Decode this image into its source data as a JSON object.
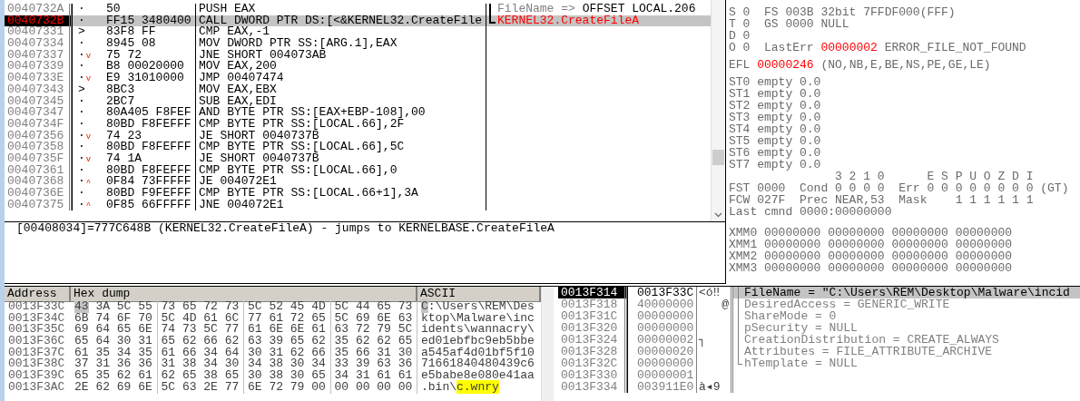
{
  "disassembly": {
    "rows": [
      {
        "address": "0040732A",
        "mark": "·",
        "jump": "",
        "hex": "50",
        "instruction": "PUSH EAX",
        "selected": false,
        "comment": {
          "kind": "arg",
          "label": "FileName =>",
          "value": "OFFSET LOCAL.206"
        }
      },
      {
        "address": "0040732B",
        "mark": "·",
        "jump": "",
        "hex": "FF15 3480400",
        "instruction": "CALL DWORD PTR DS:[<&KERNEL32.CreateFile",
        "selected": true,
        "comment": {
          "kind": "api",
          "value": "KERNEL32.CreateFileA"
        }
      },
      {
        "address": "00407331",
        "mark": ">",
        "jump": "",
        "hex": "83F8 FF",
        "instruction": "CMP EAX,-1",
        "selected": false
      },
      {
        "address": "00407334",
        "mark": "·",
        "jump": "",
        "hex": "8945 08",
        "instruction": "MOV DWORD PTR SS:[ARG.1],EAX",
        "selected": false
      },
      {
        "address": "00407337",
        "mark": "·",
        "jump": "v",
        "hex": "75 72",
        "instruction": "JNE SHORT 004073AB",
        "selected": false
      },
      {
        "address": "00407339",
        "mark": "·",
        "jump": "",
        "hex": "B8 00020000",
        "instruction": "MOV EAX,200",
        "selected": false
      },
      {
        "address": "0040733E",
        "mark": "·",
        "jump": "v",
        "hex": "E9 31010000",
        "instruction": "JMP 00407474",
        "selected": false
      },
      {
        "address": "00407343",
        "mark": ">",
        "jump": "",
        "hex": "8BC3",
        "instruction": "MOV EAX,EBX",
        "selected": false
      },
      {
        "address": "00407345",
        "mark": "·",
        "jump": "",
        "hex": "2BC7",
        "instruction": "SUB EAX,EDI",
        "selected": false
      },
      {
        "address": "00407347",
        "mark": "·",
        "jump": "",
        "hex": "80A405 F8FEF",
        "instruction": "AND BYTE PTR SS:[EAX+EBP-108],00",
        "selected": false
      },
      {
        "address": "0040734F",
        "mark": "·",
        "jump": "",
        "hex": "80BD F8FEFFF",
        "instruction": "CMP BYTE PTR SS:[LOCAL.66],2F",
        "selected": false
      },
      {
        "address": "00407356",
        "mark": "·",
        "jump": "v",
        "hex": "74 23",
        "instruction": "JE SHORT 0040737B",
        "selected": false
      },
      {
        "address": "00407358",
        "mark": "·",
        "jump": "",
        "hex": "80BD F8FEFFF",
        "instruction": "CMP BYTE PTR SS:[LOCAL.66],5C",
        "selected": false
      },
      {
        "address": "0040735F",
        "mark": "·",
        "jump": "v",
        "hex": "74 1A",
        "instruction": "JE SHORT 0040737B",
        "selected": false
      },
      {
        "address": "00407361",
        "mark": "·",
        "jump": "",
        "hex": "80BD F8FEFFF",
        "instruction": "CMP BYTE PTR SS:[LOCAL.66],0",
        "selected": false
      },
      {
        "address": "00407368",
        "mark": "·",
        "jump": "^",
        "hex": "0F84 73FFFFF",
        "instruction": "JE 004072E1",
        "selected": false
      },
      {
        "address": "0040736E",
        "mark": "·",
        "jump": "",
        "hex": "80BD F9FEFFF",
        "instruction": "CMP BYTE PTR SS:[LOCAL.66+1],3A",
        "selected": false
      },
      {
        "address": "00407375",
        "mark": "·",
        "jump": "^",
        "hex": "0F85 66FFFFF",
        "instruction": "JNE 004072E1",
        "selected": false
      }
    ]
  },
  "info_line": "[00408034]=777C648B (KERNEL32.CreateFileA) - jumps to KERNELBASE.CreateFileA",
  "registers": {
    "groups": [
      [
        [
          {
            "text": "S 0  FS 003B 32bit 7FFDF000(FFF)",
            "changed": false
          }
        ],
        [
          {
            "text": "T 0  GS 0000 NULL",
            "changed": false
          }
        ],
        [
          {
            "text": "D 0",
            "changed": false
          }
        ],
        [
          {
            "text": "O 0  LastErr ",
            "changed": false
          },
          {
            "text": "00000002",
            "changed": true
          },
          {
            "text": " ERROR_FILE_NOT_FOUND",
            "changed": false
          }
        ]
      ],
      [
        [
          {
            "text": "EFL ",
            "changed": false
          },
          {
            "text": "00000246",
            "changed": true
          },
          {
            "text": " (NO,NB,E,BE,NS,PE,GE,LE)",
            "changed": false
          }
        ]
      ],
      [
        [
          {
            "text": "ST0 empty 0.0",
            "changed": false
          }
        ],
        [
          {
            "text": "ST1 empty 0.0",
            "changed": false
          }
        ],
        [
          {
            "text": "ST2 empty 0.0",
            "changed": false
          }
        ],
        [
          {
            "text": "ST3 empty 0.0",
            "changed": false
          }
        ],
        [
          {
            "text": "ST4 empty 0.0",
            "changed": false
          }
        ],
        [
          {
            "text": "ST5 empty 0.0",
            "changed": false
          }
        ],
        [
          {
            "text": "ST6 empty 0.0",
            "changed": false
          }
        ],
        [
          {
            "text": "ST7 empty 0.0",
            "changed": false
          }
        ],
        [
          {
            "text": "               3 2 1 0      E S P U O Z D I",
            "changed": false
          }
        ],
        [
          {
            "text": "FST 0000  Cond 0 0 0 0  Err 0 0 0 0 0 0 0 0 (GT)",
            "changed": false
          }
        ],
        [
          {
            "text": "FCW 027F  Prec NEAR,53  Mask    1 1 1 1 1 1",
            "changed": false
          }
        ],
        [
          {
            "text": "Last cmnd 0000:00000000",
            "changed": false
          }
        ]
      ],
      [
        [
          {
            "text": "XMM0 00000000 00000000 00000000 00000000",
            "changed": false
          }
        ],
        [
          {
            "text": "XMM1 00000000 00000000 00000000 00000000",
            "changed": false
          }
        ],
        [
          {
            "text": "XMM2 00000000 00000000 00000000 00000000",
            "changed": false
          }
        ],
        [
          {
            "text": "XMM3 00000000 00000000 00000000 00000000",
            "changed": false
          }
        ]
      ]
    ]
  },
  "dump": {
    "columns": [
      "Address",
      "Hex dump",
      "ASCII"
    ],
    "rows": [
      {
        "address": "0013F33C",
        "bytes": [
          {
            "v": "43",
            "selected": true
          },
          {
            "v": "3A",
            "selected": false
          },
          {
            "v": "5C",
            "selected": false
          },
          {
            "v": "55",
            "selected": false
          },
          {
            "v": "73",
            "selected": false
          },
          {
            "v": "65",
            "selected": false
          },
          {
            "v": "72",
            "selected": false
          },
          {
            "v": "73",
            "selected": false
          },
          {
            "v": "5C",
            "selected": false
          },
          {
            "v": "52",
            "selected": false
          },
          {
            "v": "45",
            "selected": false
          },
          {
            "v": "4D",
            "selected": false
          },
          {
            "v": "5C",
            "selected": false
          },
          {
            "v": "44",
            "selected": false
          },
          {
            "v": "65",
            "selected": false
          },
          {
            "v": "73",
            "selected": false
          }
        ],
        "ascii": [
          {
            "text": "C",
            "selected": true,
            "found": false
          },
          {
            "text": ":\\Users\\REM\\Des",
            "selected": false,
            "found": false
          }
        ]
      },
      {
        "address": "0013F34C",
        "bytes": [
          {
            "v": "6B",
            "selected": false
          },
          {
            "v": "74",
            "selected": false
          },
          {
            "v": "6F",
            "selected": false
          },
          {
            "v": "70",
            "selected": false
          },
          {
            "v": "5C",
            "selected": false
          },
          {
            "v": "4D",
            "selected": false
          },
          {
            "v": "61",
            "selected": false
          },
          {
            "v": "6C",
            "selected": false
          },
          {
            "v": "77",
            "selected": false
          },
          {
            "v": "61",
            "selected": false
          },
          {
            "v": "72",
            "selected": false
          },
          {
            "v": "65",
            "selected": false
          },
          {
            "v": "5C",
            "selected": false
          },
          {
            "v": "69",
            "selected": false
          },
          {
            "v": "6E",
            "selected": false
          },
          {
            "v": "63",
            "selected": false
          }
        ],
        "ascii": [
          {
            "text": "ktop\\Malware\\inc",
            "selected": false,
            "found": false
          }
        ]
      },
      {
        "address": "0013F35C",
        "bytes": [
          {
            "v": "69",
            "selected": false
          },
          {
            "v": "64",
            "selected": false
          },
          {
            "v": "65",
            "selected": false
          },
          {
            "v": "6E",
            "selected": false
          },
          {
            "v": "74",
            "selected": false
          },
          {
            "v": "73",
            "selected": false
          },
          {
            "v": "5C",
            "selected": false
          },
          {
            "v": "77",
            "selected": false
          },
          {
            "v": "61",
            "selected": false
          },
          {
            "v": "6E",
            "selected": false
          },
          {
            "v": "6E",
            "selected": false
          },
          {
            "v": "61",
            "selected": false
          },
          {
            "v": "63",
            "selected": false
          },
          {
            "v": "72",
            "selected": false
          },
          {
            "v": "79",
            "selected": false
          },
          {
            "v": "5C",
            "selected": false
          }
        ],
        "ascii": [
          {
            "text": "idents\\wannacry\\",
            "selected": false,
            "found": false
          }
        ]
      },
      {
        "address": "0013F36C",
        "bytes": [
          {
            "v": "65",
            "selected": false
          },
          {
            "v": "64",
            "selected": false
          },
          {
            "v": "30",
            "selected": false
          },
          {
            "v": "31",
            "selected": false
          },
          {
            "v": "65",
            "selected": false
          },
          {
            "v": "62",
            "selected": false
          },
          {
            "v": "66",
            "selected": false
          },
          {
            "v": "62",
            "selected": false
          },
          {
            "v": "63",
            "selected": false
          },
          {
            "v": "39",
            "selected": false
          },
          {
            "v": "65",
            "selected": false
          },
          {
            "v": "62",
            "selected": false
          },
          {
            "v": "35",
            "selected": false
          },
          {
            "v": "62",
            "selected": false
          },
          {
            "v": "62",
            "selected": false
          },
          {
            "v": "65",
            "selected": false
          }
        ],
        "ascii": [
          {
            "text": "ed01ebfbc9eb5bbe",
            "selected": false,
            "found": false
          }
        ]
      },
      {
        "address": "0013F37C",
        "bytes": [
          {
            "v": "61",
            "selected": false
          },
          {
            "v": "35",
            "selected": false
          },
          {
            "v": "34",
            "selected": false
          },
          {
            "v": "35",
            "selected": false
          },
          {
            "v": "61",
            "selected": false
          },
          {
            "v": "66",
            "selected": false
          },
          {
            "v": "34",
            "selected": false
          },
          {
            "v": "64",
            "selected": false
          },
          {
            "v": "30",
            "selected": false
          },
          {
            "v": "31",
            "selected": false
          },
          {
            "v": "62",
            "selected": false
          },
          {
            "v": "66",
            "selected": false
          },
          {
            "v": "35",
            "selected": false
          },
          {
            "v": "66",
            "selected": false
          },
          {
            "v": "31",
            "selected": false
          },
          {
            "v": "30",
            "selected": false
          }
        ],
        "ascii": [
          {
            "text": "a545af4d01bf5f10",
            "selected": false,
            "found": false
          }
        ]
      },
      {
        "address": "0013F38C",
        "bytes": [
          {
            "v": "37",
            "selected": false
          },
          {
            "v": "31",
            "selected": false
          },
          {
            "v": "36",
            "selected": false
          },
          {
            "v": "36",
            "selected": false
          },
          {
            "v": "31",
            "selected": false
          },
          {
            "v": "38",
            "selected": false
          },
          {
            "v": "34",
            "selected": false
          },
          {
            "v": "30",
            "selected": false
          },
          {
            "v": "34",
            "selected": false
          },
          {
            "v": "38",
            "selected": false
          },
          {
            "v": "30",
            "selected": false
          },
          {
            "v": "34",
            "selected": false
          },
          {
            "v": "33",
            "selected": false
          },
          {
            "v": "39",
            "selected": false
          },
          {
            "v": "63",
            "selected": false
          },
          {
            "v": "36",
            "selected": false
          }
        ],
        "ascii": [
          {
            "text": "71661840480439c6",
            "selected": false,
            "found": false
          }
        ]
      },
      {
        "address": "0013F39C",
        "bytes": [
          {
            "v": "65",
            "selected": false
          },
          {
            "v": "35",
            "selected": false
          },
          {
            "v": "62",
            "selected": false
          },
          {
            "v": "61",
            "selected": false
          },
          {
            "v": "62",
            "selected": false
          },
          {
            "v": "65",
            "selected": false
          },
          {
            "v": "38",
            "selected": false
          },
          {
            "v": "65",
            "selected": false
          },
          {
            "v": "30",
            "selected": false
          },
          {
            "v": "38",
            "selected": false
          },
          {
            "v": "30",
            "selected": false
          },
          {
            "v": "65",
            "selected": false
          },
          {
            "v": "34",
            "selected": false
          },
          {
            "v": "31",
            "selected": false
          },
          {
            "v": "61",
            "selected": false
          },
          {
            "v": "61",
            "selected": false
          }
        ],
        "ascii": [
          {
            "text": "e5babe8e080e41aa",
            "selected": false,
            "found": false
          }
        ]
      },
      {
        "address": "0013F3AC",
        "bytes": [
          {
            "v": "2E",
            "selected": false
          },
          {
            "v": "62",
            "selected": false
          },
          {
            "v": "69",
            "selected": false
          },
          {
            "v": "6E",
            "selected": false
          },
          {
            "v": "5C",
            "selected": false
          },
          {
            "v": "63",
            "selected": false
          },
          {
            "v": "2E",
            "selected": false
          },
          {
            "v": "77",
            "selected": false
          },
          {
            "v": "6E",
            "selected": false
          },
          {
            "v": "72",
            "selected": false
          },
          {
            "v": "79",
            "selected": false
          },
          {
            "v": "00",
            "selected": false
          },
          {
            "v": "00",
            "selected": false
          },
          {
            "v": "00",
            "selected": false
          },
          {
            "v": "00",
            "selected": false
          },
          {
            "v": "00",
            "selected": false
          }
        ],
        "ascii": [
          {
            "text": ".bin\\",
            "selected": false,
            "found": false
          },
          {
            "text": "c.wnry",
            "selected": false,
            "found": true
          }
        ]
      }
    ]
  },
  "stack": {
    "rows": [
      {
        "address": "0013F314",
        "value": "0013F33C",
        "ascii": "<ó‼",
        "selected": true,
        "comment": "FileName = \"C:\\Users\\REM\\Desktop\\Malware\\incid",
        "bracket": true,
        "bracket_end": false
      },
      {
        "address": "0013F318",
        "value": "40000000",
        "ascii": "@",
        "selected": false,
        "comment": "DesiredAccess = GENERIC_WRITE",
        "bracket": true,
        "bracket_end": false
      },
      {
        "address": "0013F31C",
        "value": "00000000",
        "ascii": "",
        "selected": false,
        "comment": "ShareMode = 0",
        "bracket": true,
        "bracket_end": false
      },
      {
        "address": "0013F320",
        "value": "00000000",
        "ascii": "",
        "selected": false,
        "comment": "pSecurity = NULL",
        "bracket": true,
        "bracket_end": false
      },
      {
        "address": "0013F324",
        "value": "00000002",
        "ascii": "┐",
        "selected": false,
        "comment": "CreationDistribution = CREATE_ALWAYS",
        "bracket": true,
        "bracket_end": false
      },
      {
        "address": "0013F328",
        "value": "00000020",
        "ascii": "",
        "selected": false,
        "comment": "Attributes = FILE_ATTRIBUTE_ARCHIVE",
        "bracket": true,
        "bracket_end": false
      },
      {
        "address": "0013F32C",
        "value": "00000000",
        "ascii": "",
        "selected": false,
        "comment": "hTemplate = NULL",
        "bracket": true,
        "bracket_end": true
      },
      {
        "address": "0013F330",
        "value": "00000001",
        "ascii": "",
        "selected": false,
        "bracket": false,
        "bracket_end": false
      },
      {
        "address": "0013F334",
        "value": "003911E0",
        "ascii": "à◂9",
        "selected": false,
        "bracket": false,
        "bracket_end": false
      }
    ]
  }
}
